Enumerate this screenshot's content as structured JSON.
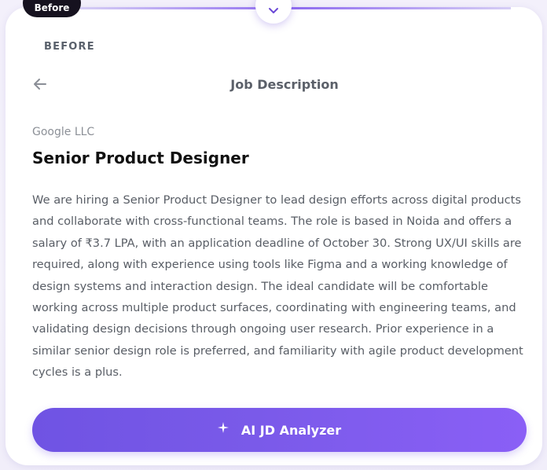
{
  "badge": {
    "label": "Before"
  },
  "section": {
    "label": "BEFORE"
  },
  "header": {
    "title": "Job Description",
    "back_icon": "arrow-left-icon",
    "toggle_icon": "chevron-down-icon"
  },
  "job": {
    "company": "Google LLC",
    "title": "Senior Product Designer",
    "description": "We are hiring a Senior Product Designer to lead design efforts across digital products and collaborate with cross-functional teams. The role is based in Noida and offers a salary of ₹3.7 LPA, with an application deadline of October 30. Strong UX/UI skills are required, along with experience using tools like Figma and a working knowledge of design systems and interaction design. The ideal candidate will be comfortable working across multiple product surfaces, coordinating with engineering teams, and validating design decisions through ongoing user research. Prior experience in a similar senior design role is preferred, and familiarity with agile product development cycles is a plus."
  },
  "action": {
    "label": "AI JD Analyzer",
    "icon": "sparkle-icon"
  },
  "colors": {
    "accent": "#7a5ae9",
    "accent_end": "#8a5ff6",
    "pill_bg": "#16121f",
    "title_text": "#111111",
    "body_text": "#595e66"
  }
}
